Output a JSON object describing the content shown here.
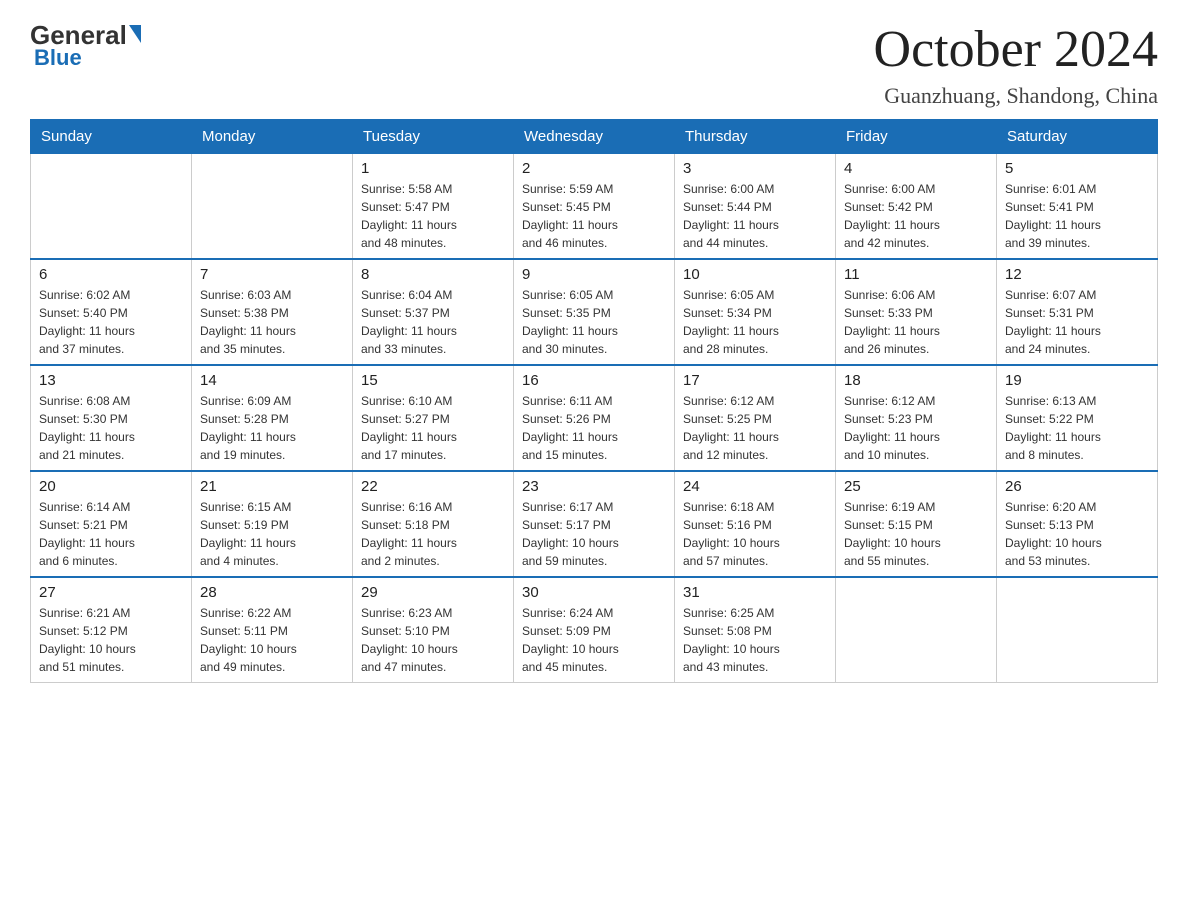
{
  "header": {
    "logo": {
      "general": "General",
      "blue": "Blue"
    },
    "title": "October 2024",
    "subtitle": "Guanzhuang, Shandong, China"
  },
  "calendar": {
    "days_of_week": [
      "Sunday",
      "Monday",
      "Tuesday",
      "Wednesday",
      "Thursday",
      "Friday",
      "Saturday"
    ],
    "weeks": [
      [
        {
          "day": "",
          "info": ""
        },
        {
          "day": "",
          "info": ""
        },
        {
          "day": "1",
          "info": "Sunrise: 5:58 AM\nSunset: 5:47 PM\nDaylight: 11 hours\nand 48 minutes."
        },
        {
          "day": "2",
          "info": "Sunrise: 5:59 AM\nSunset: 5:45 PM\nDaylight: 11 hours\nand 46 minutes."
        },
        {
          "day": "3",
          "info": "Sunrise: 6:00 AM\nSunset: 5:44 PM\nDaylight: 11 hours\nand 44 minutes."
        },
        {
          "day": "4",
          "info": "Sunrise: 6:00 AM\nSunset: 5:42 PM\nDaylight: 11 hours\nand 42 minutes."
        },
        {
          "day": "5",
          "info": "Sunrise: 6:01 AM\nSunset: 5:41 PM\nDaylight: 11 hours\nand 39 minutes."
        }
      ],
      [
        {
          "day": "6",
          "info": "Sunrise: 6:02 AM\nSunset: 5:40 PM\nDaylight: 11 hours\nand 37 minutes."
        },
        {
          "day": "7",
          "info": "Sunrise: 6:03 AM\nSunset: 5:38 PM\nDaylight: 11 hours\nand 35 minutes."
        },
        {
          "day": "8",
          "info": "Sunrise: 6:04 AM\nSunset: 5:37 PM\nDaylight: 11 hours\nand 33 minutes."
        },
        {
          "day": "9",
          "info": "Sunrise: 6:05 AM\nSunset: 5:35 PM\nDaylight: 11 hours\nand 30 minutes."
        },
        {
          "day": "10",
          "info": "Sunrise: 6:05 AM\nSunset: 5:34 PM\nDaylight: 11 hours\nand 28 minutes."
        },
        {
          "day": "11",
          "info": "Sunrise: 6:06 AM\nSunset: 5:33 PM\nDaylight: 11 hours\nand 26 minutes."
        },
        {
          "day": "12",
          "info": "Sunrise: 6:07 AM\nSunset: 5:31 PM\nDaylight: 11 hours\nand 24 minutes."
        }
      ],
      [
        {
          "day": "13",
          "info": "Sunrise: 6:08 AM\nSunset: 5:30 PM\nDaylight: 11 hours\nand 21 minutes."
        },
        {
          "day": "14",
          "info": "Sunrise: 6:09 AM\nSunset: 5:28 PM\nDaylight: 11 hours\nand 19 minutes."
        },
        {
          "day": "15",
          "info": "Sunrise: 6:10 AM\nSunset: 5:27 PM\nDaylight: 11 hours\nand 17 minutes."
        },
        {
          "day": "16",
          "info": "Sunrise: 6:11 AM\nSunset: 5:26 PM\nDaylight: 11 hours\nand 15 minutes."
        },
        {
          "day": "17",
          "info": "Sunrise: 6:12 AM\nSunset: 5:25 PM\nDaylight: 11 hours\nand 12 minutes."
        },
        {
          "day": "18",
          "info": "Sunrise: 6:12 AM\nSunset: 5:23 PM\nDaylight: 11 hours\nand 10 minutes."
        },
        {
          "day": "19",
          "info": "Sunrise: 6:13 AM\nSunset: 5:22 PM\nDaylight: 11 hours\nand 8 minutes."
        }
      ],
      [
        {
          "day": "20",
          "info": "Sunrise: 6:14 AM\nSunset: 5:21 PM\nDaylight: 11 hours\nand 6 minutes."
        },
        {
          "day": "21",
          "info": "Sunrise: 6:15 AM\nSunset: 5:19 PM\nDaylight: 11 hours\nand 4 minutes."
        },
        {
          "day": "22",
          "info": "Sunrise: 6:16 AM\nSunset: 5:18 PM\nDaylight: 11 hours\nand 2 minutes."
        },
        {
          "day": "23",
          "info": "Sunrise: 6:17 AM\nSunset: 5:17 PM\nDaylight: 10 hours\nand 59 minutes."
        },
        {
          "day": "24",
          "info": "Sunrise: 6:18 AM\nSunset: 5:16 PM\nDaylight: 10 hours\nand 57 minutes."
        },
        {
          "day": "25",
          "info": "Sunrise: 6:19 AM\nSunset: 5:15 PM\nDaylight: 10 hours\nand 55 minutes."
        },
        {
          "day": "26",
          "info": "Sunrise: 6:20 AM\nSunset: 5:13 PM\nDaylight: 10 hours\nand 53 minutes."
        }
      ],
      [
        {
          "day": "27",
          "info": "Sunrise: 6:21 AM\nSunset: 5:12 PM\nDaylight: 10 hours\nand 51 minutes."
        },
        {
          "day": "28",
          "info": "Sunrise: 6:22 AM\nSunset: 5:11 PM\nDaylight: 10 hours\nand 49 minutes."
        },
        {
          "day": "29",
          "info": "Sunrise: 6:23 AM\nSunset: 5:10 PM\nDaylight: 10 hours\nand 47 minutes."
        },
        {
          "day": "30",
          "info": "Sunrise: 6:24 AM\nSunset: 5:09 PM\nDaylight: 10 hours\nand 45 minutes."
        },
        {
          "day": "31",
          "info": "Sunrise: 6:25 AM\nSunset: 5:08 PM\nDaylight: 10 hours\nand 43 minutes."
        },
        {
          "day": "",
          "info": ""
        },
        {
          "day": "",
          "info": ""
        }
      ]
    ]
  }
}
